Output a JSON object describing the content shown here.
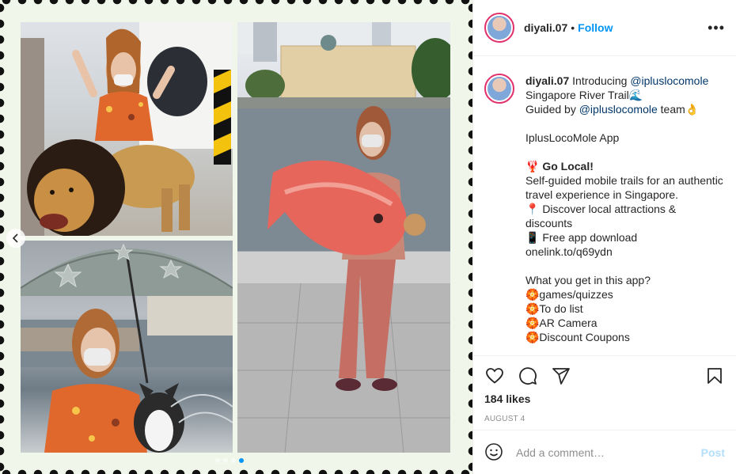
{
  "post": {
    "username": "diyali.07",
    "follow_label": "Follow",
    "more_label": "•••"
  },
  "caption": {
    "username": "diyali.07",
    "lines": [
      "Introducing ",
      "@ipluslocomole",
      "Singapore River Trail🌊",
      "Guided by ",
      "@ipluslocomole",
      " team👌",
      "IplusLocoMole App",
      "🦞 Go Local!",
      "Self-guided mobile trails for an authentic travel experience in Singapore.",
      "📍 Discover local attractions & discounts",
      "📱 Free app download",
      "onelink.to/q69ydn",
      "What you get in this app?",
      "🏵️games/quizzes",
      "🏵️To do list",
      "🏵️AR Camera",
      "🏵️Discount Coupons"
    ]
  },
  "engagement": {
    "likes": "184 likes",
    "date": "AUGUST 4"
  },
  "comment": {
    "placeholder": "Add a comment…",
    "post_label": "Post"
  },
  "carousel": {
    "dot_count": 4,
    "active_index": 3
  }
}
